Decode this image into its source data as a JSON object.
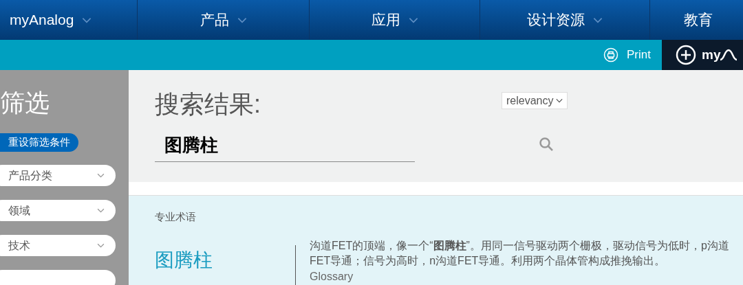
{
  "nav": {
    "items": [
      {
        "label": "myAnalog"
      },
      {
        "label": "产品"
      },
      {
        "label": "应用"
      },
      {
        "label": "设计资源"
      },
      {
        "label": "教育"
      }
    ]
  },
  "toolbar": {
    "print": "Print",
    "account": "my"
  },
  "filters": {
    "title": "筛选",
    "reset": "重设筛选条件",
    "dropdowns": [
      {
        "label": "产品分类"
      },
      {
        "label": "领域"
      },
      {
        "label": "技术"
      }
    ]
  },
  "search": {
    "heading": "搜索结果:",
    "query": "图腾柱",
    "sort": "relevancy"
  },
  "result": {
    "category": "专业术语",
    "title": "图腾柱",
    "description": "沟道FET的顶端，像一个“**图腾柱**”。用同一信号驱动两个栅极，驱动信号为低时，p沟道FET导通；信号为高时，n沟道FET导通。利用两个晶体管构成推挽输出。",
    "source": "Glossary"
  }
}
